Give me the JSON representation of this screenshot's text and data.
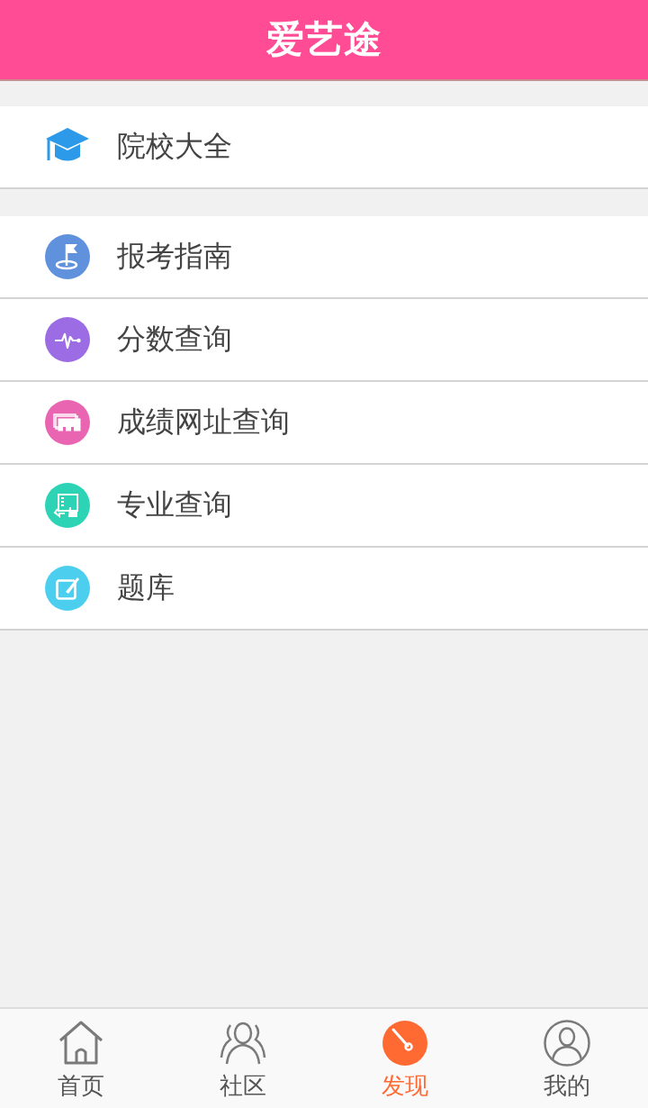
{
  "header": {
    "title": "爱艺途"
  },
  "sections": [
    {
      "items": [
        {
          "label": "院校大全"
        }
      ]
    },
    {
      "items": [
        {
          "label": "报考指南"
        },
        {
          "label": "分数查询"
        },
        {
          "label": "成绩网址查询"
        },
        {
          "label": "专业查询"
        },
        {
          "label": "题库"
        }
      ]
    }
  ],
  "tab_bar": [
    {
      "label": "首页",
      "selected": false
    },
    {
      "label": "社区",
      "selected": false
    },
    {
      "label": "发现",
      "selected": true
    },
    {
      "label": "我的",
      "selected": false
    }
  ]
}
